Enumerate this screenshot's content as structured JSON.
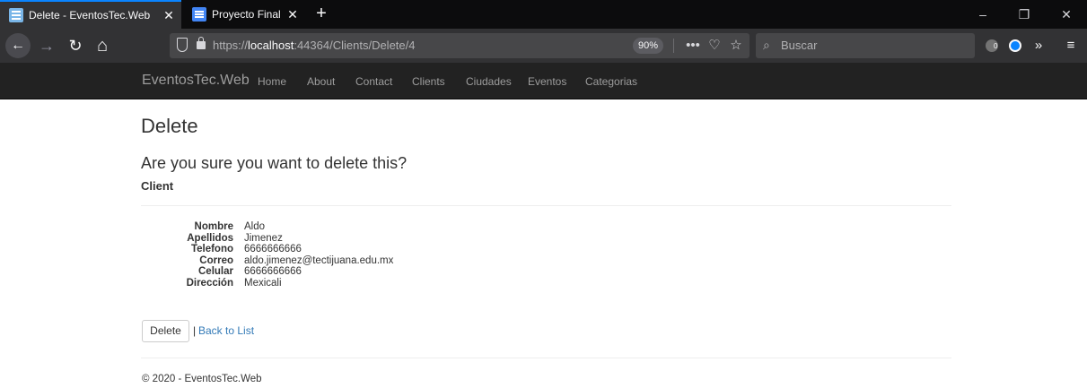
{
  "browser": {
    "tabs": [
      {
        "title": "Delete - EventosTec.Web",
        "close": "✕"
      },
      {
        "title": "Proyecto Final Control de Reser",
        "close": "✕"
      }
    ],
    "new_tab": "+",
    "window_controls": {
      "minimize": "–",
      "restore": "❐",
      "close": "✕"
    },
    "nav": {
      "back": "←",
      "forward": "→",
      "reload": "↻",
      "home": "⌂"
    },
    "url_prefix": "https://",
    "url_host": "localhost",
    "url_rest": ":44364/Clients/Delete/4",
    "zoom": "90%",
    "page_actions": "•••",
    "pocket": "♡",
    "bookmark": "☆",
    "search_icon": "⌕",
    "search_placeholder": "Buscar",
    "ext_badge": "0",
    "overflow": "»",
    "menu": "≡"
  },
  "site": {
    "brand": "EventosTec.Web",
    "nav": [
      "Home",
      "About",
      "Contact",
      "Clients",
      "Ciudades",
      "Eventos",
      "Categorias"
    ]
  },
  "page": {
    "title": "Delete",
    "question": "Are you sure you want to delete this?",
    "entity": "Client",
    "fields": [
      {
        "label": "Nombre",
        "value": "Aldo"
      },
      {
        "label": "Apellidos",
        "value": "Jimenez"
      },
      {
        "label": "Telefono",
        "value": "6666666666"
      },
      {
        "label": "Correo",
        "value": "aldo.jimenez@tectijuana.edu.mx"
      },
      {
        "label": "Celular",
        "value": "6666666666"
      },
      {
        "label": "Dirección",
        "value": "Mexicali"
      }
    ],
    "delete_button": "Delete",
    "separator": "|",
    "back_link": "Back to List",
    "footer": "© 2020 - EventosTec.Web"
  }
}
